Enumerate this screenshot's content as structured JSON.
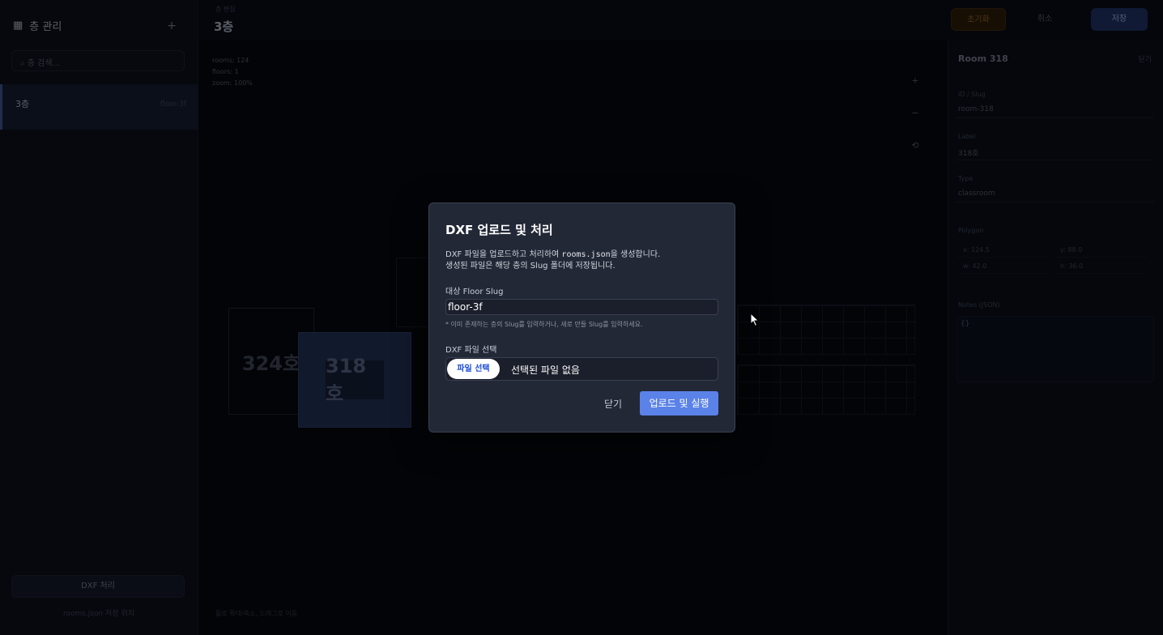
{
  "sidebar": {
    "title": "층 관리",
    "add_icon": "plus-icon",
    "search_placeholder": "층 검색...",
    "items": [
      {
        "label": "3층",
        "meta": "floor-3f"
      }
    ],
    "bottom_button": "DXF 처리",
    "footer": "rooms.json 저장 위치"
  },
  "header": {
    "crumb": "층 편집",
    "title": "3층",
    "buttons": {
      "warn": "초기화",
      "ghost": "취소",
      "primary": "저장"
    }
  },
  "canvas": {
    "info": [
      "rooms: 124",
      "floors: 1",
      "zoom: 100%"
    ],
    "zoom_controls": [
      "+",
      "−",
      "⟲"
    ],
    "rooms": [
      "324호",
      "318호"
    ],
    "footer": "휠로 확대/축소, 드래그로 이동"
  },
  "panel": {
    "title": "Room 318",
    "title_right": "닫기",
    "fields": [
      {
        "label": "ID / Slug",
        "value": "room-318"
      },
      {
        "label": "Label",
        "value": "318호"
      },
      {
        "label": "Type",
        "value": "classroom"
      }
    ],
    "section_label": "Polygon",
    "chips": [
      "x: 124.5",
      "y: 88.0",
      "w: 42.0",
      "h: 36.0"
    ],
    "notes_label": "Notes (JSON)",
    "notes_value": "{}"
  },
  "modal": {
    "title": "DXF 업로드 및 처리",
    "desc_line1_pre": "DXF 파일을 업로드하고 처리하여 ",
    "desc_code": "rooms.json",
    "desc_line1_post": "을 생성합니다.",
    "desc_line2": "생성된 파일은 해당 층의 Slug 폴더에 저장됩니다.",
    "slug_label": "대상 Floor Slug",
    "slug_value": "floor-3f",
    "slug_hint": "* 이미 존재하는 층의 Slug를 입력하거나, 새로 만들 Slug를 입력하세요.",
    "file_label": "DXF 파일 선택",
    "file_button": "파일 선택",
    "file_status": "선택된 파일 없음",
    "close_label": "닫기",
    "submit_label": "업로드 및 실행"
  },
  "colors": {
    "accent": "#5b82e8",
    "modal_bg": "#232837",
    "page_bg": "#060810"
  }
}
